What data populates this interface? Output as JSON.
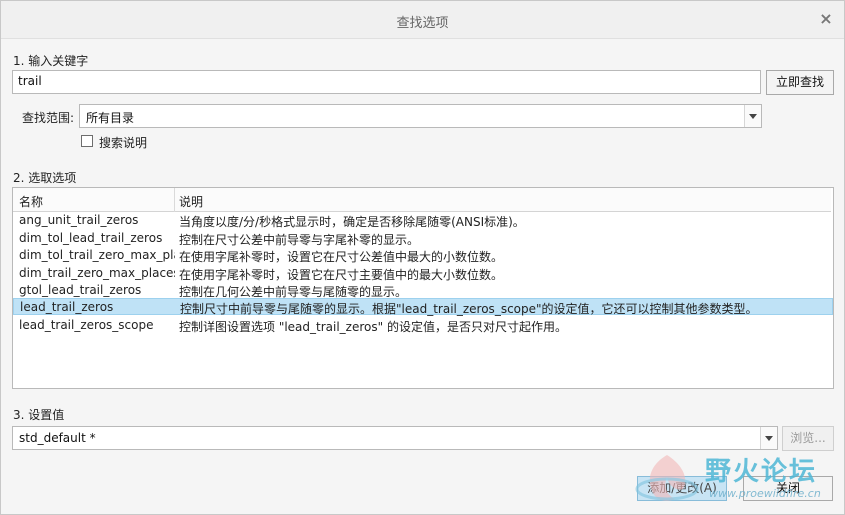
{
  "dialog": {
    "title": "查找选项"
  },
  "section1": {
    "label": "1. 输入关键字",
    "keyword": "trail",
    "search_button": "立即查找"
  },
  "scope": {
    "label": "查找范围:",
    "selected": "所有目录"
  },
  "search_desc": {
    "label": "搜索说明",
    "checked": false
  },
  "section2": {
    "label": "2. 选取选项"
  },
  "table": {
    "columns": [
      "名称",
      "说明"
    ],
    "rows": [
      {
        "name": "ang_unit_trail_zeros",
        "desc": "当角度以度/分/秒格式显示时，确定是否移除尾随零(ANSI标准)。"
      },
      {
        "name": "dim_tol_lead_trail_zeros",
        "desc": "控制在尺寸公差中前导零与字尾补零的显示。"
      },
      {
        "name": "dim_tol_trail_zero_max_pla",
        "desc": "在使用字尾补零时，设置它在尺寸公差值中最大的小数位数。"
      },
      {
        "name": "dim_trail_zero_max_places",
        "desc": "在使用字尾补零时，设置它在尺寸主要值中的最大小数位数。"
      },
      {
        "name": "gtol_lead_trail_zeros",
        "desc": "控制在几何公差中前导零与尾随零的显示。"
      },
      {
        "name": "lead_trail_zeros",
        "desc": "控制尺寸中前导零与尾随零的显示。根据\"lead_trail_zeros_scope\"的设定值，它还可以控制其他参数类型。",
        "selected": true
      },
      {
        "name": "lead_trail_zeros_scope",
        "desc": "控制详图设置选项 \"lead_trail_zeros\" 的设定值，是否只对尺寸起作用。"
      }
    ]
  },
  "section3": {
    "label": "3. 设置值",
    "value": "std_default *",
    "browse_button": "浏览..."
  },
  "footer": {
    "add_change_button": "添加/更改(A)",
    "close_button": "关闭"
  },
  "watermark": {
    "brand": "野火论坛",
    "url": "www.proewildfire.cn"
  }
}
